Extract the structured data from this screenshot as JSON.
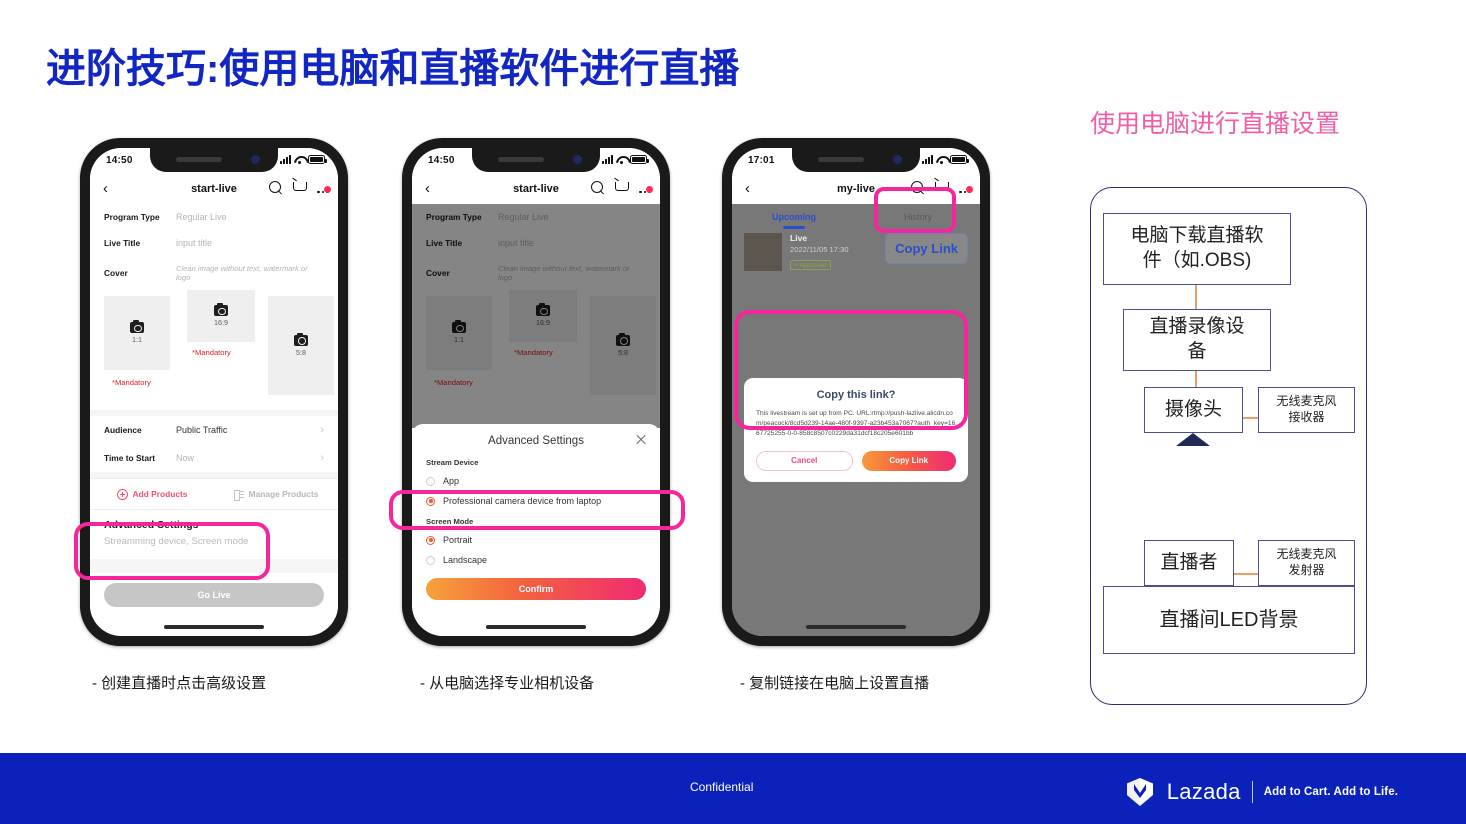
{
  "slide": {
    "title": "进阶技巧:使用电脑和直播软件进行直播",
    "title_color": "#1226c4"
  },
  "phones": [
    {
      "id": "phone-1",
      "status": {
        "time": "14:50"
      },
      "nav": {
        "title": "start-live",
        "back": "‹"
      },
      "form": [
        {
          "label": "Program Type",
          "value": "Regular Live"
        },
        {
          "label": "Live Title",
          "value": "input title"
        },
        {
          "label": "Cover",
          "value": "Clean image without text, watermark or logo"
        }
      ],
      "covers": [
        {
          "ratio": "1:1",
          "mandatory": "*Mandatory"
        },
        {
          "ratio": "16:9",
          "mandatory": "*Mandatory"
        },
        {
          "ratio": "5:8",
          "mandatory": ""
        }
      ],
      "rows": [
        {
          "label": "Audience",
          "value": "Public Traffic",
          "chevron": "›"
        },
        {
          "label": "Time to Start",
          "value": "Now",
          "chevron": "›"
        }
      ],
      "products": {
        "add": "Add Products",
        "manage": "Manage Products"
      },
      "advanced": {
        "title": "Advanced Settings",
        "subtitle": "Streamming device, Screen mode"
      },
      "cta": "Go Live"
    },
    {
      "id": "phone-2",
      "status": {
        "time": "14:50"
      },
      "nav": {
        "title": "start-live",
        "back": "‹"
      },
      "form": [
        {
          "label": "Program Type",
          "value": "Regular Live"
        },
        {
          "label": "Live Title",
          "value": "input title"
        },
        {
          "label": "Cover",
          "value": "Clean image without text, watermark or logo"
        }
      ],
      "covers": [
        {
          "ratio": "1:1",
          "mandatory": "*Mandatory"
        },
        {
          "ratio": "16:9",
          "mandatory": "*Mandatory"
        },
        {
          "ratio": "5:8",
          "mandatory": ""
        }
      ],
      "sheet": {
        "title": "Advanced Settings",
        "groups": [
          {
            "label": "Stream Device",
            "options": [
              {
                "text": "App",
                "selected": false
              },
              {
                "text": "Professional camera device from laptop",
                "selected": true
              }
            ]
          },
          {
            "label": "Screen Mode",
            "options": [
              {
                "text": "Portrait",
                "selected": true
              },
              {
                "text": "Landscape",
                "selected": false
              }
            ]
          }
        ],
        "confirm": "Confirm"
      }
    },
    {
      "id": "phone-3",
      "status": {
        "time": "17:01"
      },
      "nav": {
        "title": "my-live",
        "back": "‹"
      },
      "tabs": [
        {
          "label": "Upcoming",
          "active": true
        },
        {
          "label": "History",
          "active": false
        }
      ],
      "live_card": {
        "title": "Live",
        "datetime": "2022/11/05 17:30",
        "status_badge": "✓Approved",
        "copy_link_button": "Copy Link"
      },
      "dialog": {
        "title": "Copy this link?",
        "body": "This livestream is set up from PC. URL:rtmp://push-lazlive.alicdn.com/peacock/8cd5d239-14ae-480f-9397-a23b453a7067?auth_key=1667725255-0-0-858c8507c0229da31dcf18c205e601bb",
        "cancel": "Cancel",
        "confirm": "Copy Link"
      }
    }
  ],
  "captions": [
    "- 创建直播时点击高级设置",
    "- 从电脑选择专业相机设备",
    "- 复制链接在电脑上设置直播"
  ],
  "diagram": {
    "title": "使用电脑进行直播设置",
    "title_color": "#ef5fa7",
    "nodes": [
      {
        "id": "n1",
        "text": "电脑下载直播软\n件（如.OBS)"
      },
      {
        "id": "n2",
        "text": "直播录像设\n备"
      },
      {
        "id": "n3",
        "text": "摄像头"
      },
      {
        "id": "n4",
        "text": "无线麦克风\n接收器"
      },
      {
        "id": "n5",
        "text": "直播者"
      },
      {
        "id": "n6",
        "text": "无线麦克风\n发射器"
      },
      {
        "id": "n7",
        "text": "直播间LED背景"
      }
    ]
  },
  "footer": {
    "confidential": "Confidential",
    "brand_name": "Lazada",
    "tagline": "Add to Cart. Add to Life.",
    "bg_color": "#0b22ba"
  }
}
